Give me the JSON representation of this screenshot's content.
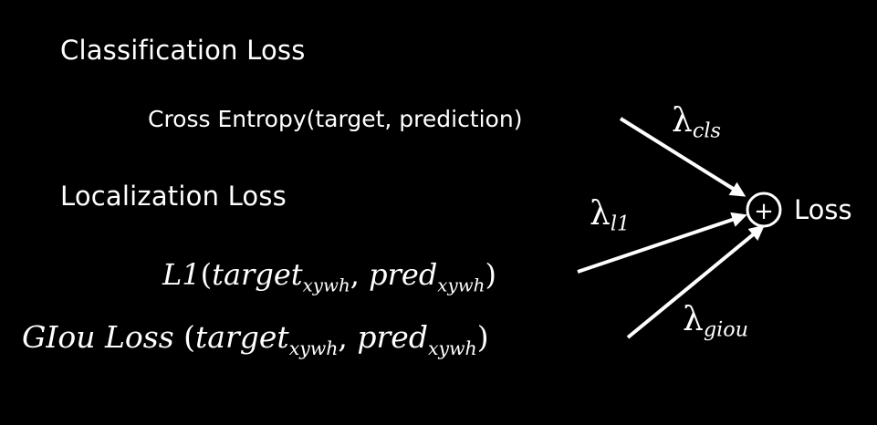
{
  "headings": {
    "classification": "Classification Loss",
    "localization": "Localization Loss"
  },
  "terms": {
    "cross_entropy": "Cross Entropy(target, prediction)",
    "l1": {
      "func": "L1",
      "open": "(",
      "arg1": "target",
      "arg1_sub": "xywh",
      "sep": ", ",
      "arg2": "pred",
      "arg2_sub": "xywh",
      "close": ")"
    },
    "giou": {
      "func": "GIou Loss",
      "open": "(",
      "arg1": "target",
      "arg1_sub": "xywh",
      "sep": ", ",
      "arg2": "pred",
      "arg2_sub": "xywh",
      "close": ")"
    }
  },
  "weights": {
    "cls": {
      "symbol": "λ",
      "sub": "cls"
    },
    "l1": {
      "symbol": "λ",
      "sub": "l1"
    },
    "giou": {
      "symbol": "λ",
      "sub": "giou"
    }
  },
  "sum_node": {
    "symbol": "+"
  },
  "output": "Loss",
  "colors": {
    "background": "#000000",
    "foreground": "#ffffff"
  }
}
